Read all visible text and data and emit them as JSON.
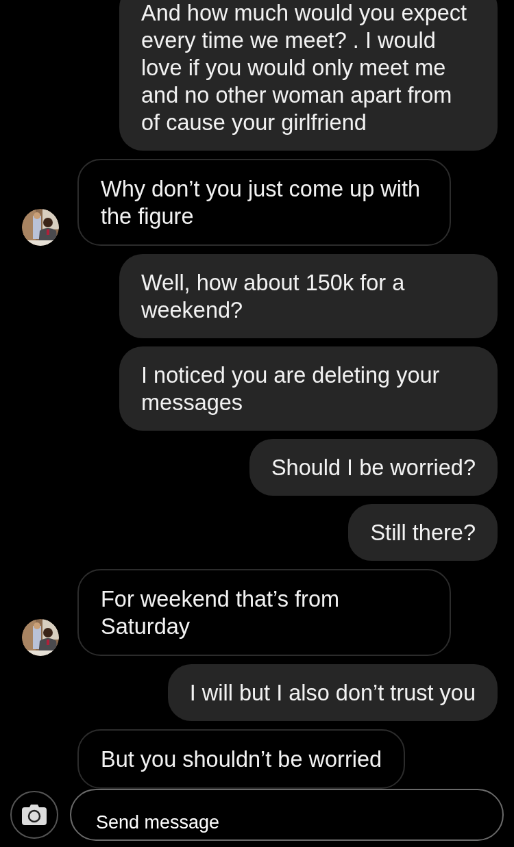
{
  "messages": [
    {
      "kind": "outgoing",
      "text": "And how much would you expect every time we meet? . I would love if you would only meet me and no other woman apart from of cause your girlfriend"
    },
    {
      "kind": "incoming",
      "avatar": true,
      "text": "Why don’t you just come up with the figure"
    },
    {
      "kind": "outgoing",
      "text": "Well, how about 150k for a weekend?"
    },
    {
      "kind": "outgoing",
      "text": "I noticed you are deleting your messages"
    },
    {
      "kind": "outgoing",
      "text": "Should I be worried?"
    },
    {
      "kind": "outgoing",
      "text": "Still there?"
    },
    {
      "kind": "incoming",
      "avatar": true,
      "text": "For weekend that’s from Saturday"
    },
    {
      "kind": "outgoing",
      "text": "I will but I also don’t trust you"
    },
    {
      "kind": "incoming",
      "avatar": false,
      "text": "But you shouldn’t be worried"
    }
  ],
  "composer": {
    "placeholder": "Send message"
  }
}
